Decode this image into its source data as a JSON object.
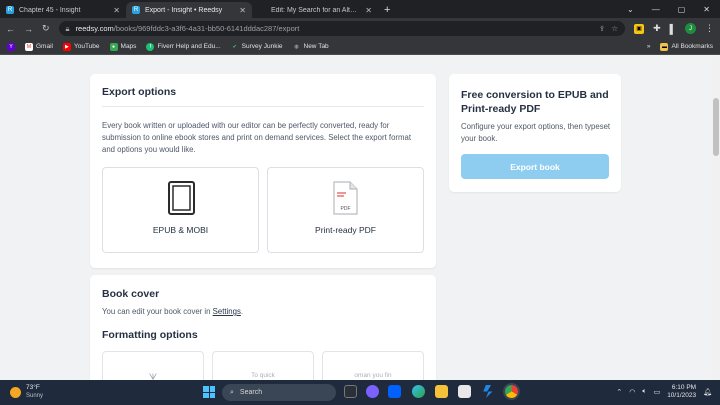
{
  "tabs": [
    {
      "label": "Chapter 45 - Insight",
      "active": false
    },
    {
      "label": "Export - Insight • Reedsy",
      "active": true
    },
    {
      "label": "Edit: My Search for an Alternati",
      "active": false
    }
  ],
  "address": {
    "host": "reedsy.com",
    "path": "/books/969fddc3-a3f6-4a31-bb50-6141dddac287/export"
  },
  "bookmarks": [
    "Gmail",
    "YouTube",
    "Maps",
    "Fiverr Help and Edu...",
    "Survey Junkie",
    "New Tab"
  ],
  "all_bookmarks": "All Bookmarks",
  "profile_initial": "J",
  "export_options": {
    "title": "Export options",
    "description": "Every book written or uploaded with our editor can be perfectly converted, ready for submission to online ebook stores and print on demand services. Select the export format and options you would like.",
    "formats": [
      {
        "label": "EPUB & MOBI"
      },
      {
        "label": "Print-ready PDF",
        "badge": "PDF"
      }
    ]
  },
  "sidebar": {
    "title": "Free conversion to EPUB and Print-ready PDF",
    "description": "Configure your export options, then typeset your book.",
    "button": "Export book"
  },
  "book_cover": {
    "title": "Book cover",
    "text_before": "You can edit your book cover in ",
    "link": "Settings",
    "text_after": "."
  },
  "formatting": {
    "title": "Formatting options",
    "thumbs": [
      "",
      "To quick",
      "oman you fin"
    ]
  },
  "taskbar": {
    "temperature": "73°F",
    "condition": "Sunny",
    "search_placeholder": "Search",
    "time": "6:10 PM",
    "date": "10/1/2023"
  },
  "colors": {
    "primary_button": "#8fcdf0",
    "taskbar": "#1f2a3c",
    "chrome_dark": "#202124"
  }
}
